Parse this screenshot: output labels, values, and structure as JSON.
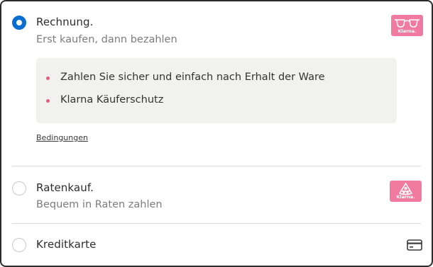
{
  "payment_options": {
    "invoice": {
      "title": "Rechnung.",
      "subtitle": "Erst kaufen, dann bezahlen",
      "selected": true,
      "badge_text": "Klarna.",
      "badge_icon": "glasses-icon",
      "benefits": [
        "Zahlen Sie sicher und einfach nach Erhalt der Ware",
        "Klarna Käuferschutz"
      ],
      "terms_link": "Bedingungen"
    },
    "installments": {
      "title": "Ratenkauf.",
      "subtitle": "Bequem in Raten zahlen",
      "selected": false,
      "badge_text": "Klarna.",
      "badge_icon": "pizza-slice-icon"
    },
    "credit_card": {
      "title": "Kreditkarte",
      "selected": false,
      "icon": "credit-card-icon"
    }
  },
  "colors": {
    "accent": "#0a6fd1",
    "klarna_pink": "#f07aa0",
    "bullet": "#e85b7e",
    "info_bg": "#f1f1ef"
  }
}
